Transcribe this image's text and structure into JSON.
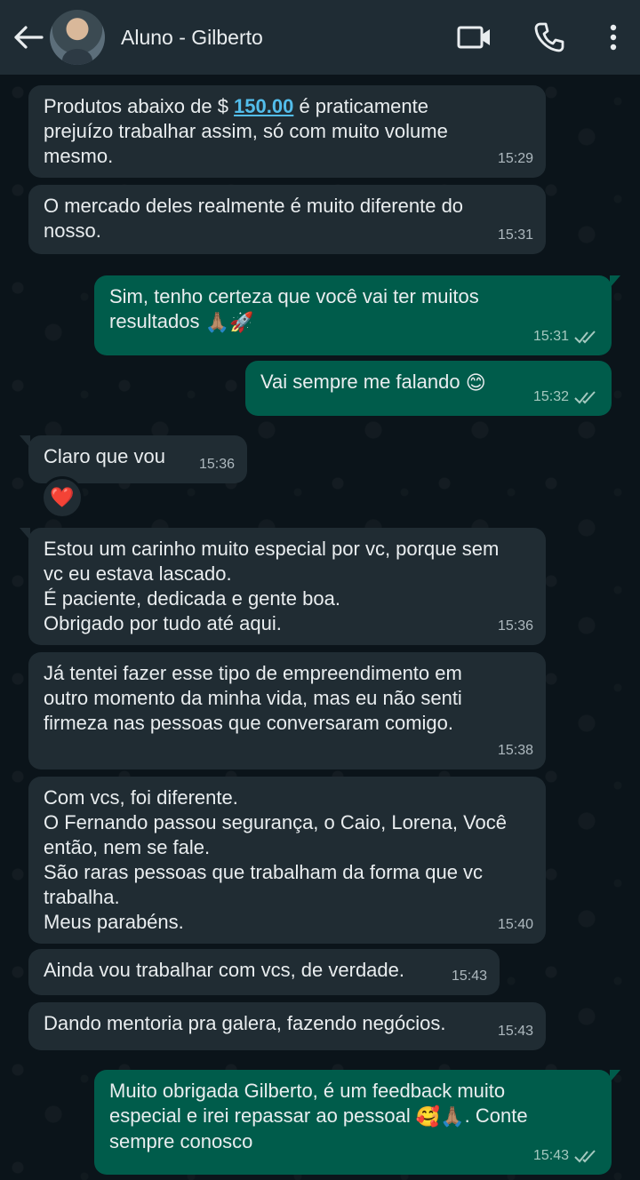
{
  "header": {
    "contact_name": "Aluno - Gilberto"
  },
  "icons": {
    "back": "arrow-left-icon",
    "video": "video-camera-icon",
    "call": "phone-icon",
    "menu": "more-vertical-icon",
    "read": "double-check-icon",
    "reaction": "red-heart-icon"
  },
  "messages": [
    {
      "dir": "in",
      "pre": "Produtos abaixo de $ ",
      "link": "150.00",
      "post": " é praticamente\nprejuízo trabalhar assim, só com muito volume\nmesmo.",
      "time": "15:29"
    },
    {
      "dir": "in",
      "text": "O mercado deles realmente é muito diferente do\nnosso.",
      "time": "15:31"
    },
    {
      "dir": "out",
      "text": "Sim, tenho certeza que você vai ter muitos\nresultados",
      "emojis": [
        "🙏🏽",
        "🚀"
      ],
      "time": "15:31"
    },
    {
      "dir": "out",
      "text": "Vai sempre me falando",
      "emojis": [
        "😊"
      ],
      "time": "15:32"
    },
    {
      "dir": "in",
      "text": "Claro que vou",
      "time": "15:36",
      "reaction": "❤️"
    },
    {
      "dir": "in",
      "text": "Estou um carinho muito especial por vc, porque sem\nvc eu estava lascado.\nÉ paciente, dedicada e gente boa.\nObrigado por tudo até aqui.",
      "time": "15:36"
    },
    {
      "dir": "in",
      "text": "Já tentei fazer esse tipo de empreendimento em\noutro momento da minha vida, mas eu não senti\nfirmeza nas pessoas que conversaram comigo.",
      "time": "15:38"
    },
    {
      "dir": "in",
      "text": "Com vcs, foi diferente.\nO Fernando passou segurança, o Caio, Lorena, Você\nentão, nem se fale.\nSão raras pessoas que trabalham da forma que vc\ntrabalha.\nMeus parabéns.",
      "time": "15:40"
    },
    {
      "dir": "in",
      "text": "Ainda vou trabalhar com vcs, de verdade.",
      "time": "15:43"
    },
    {
      "dir": "in",
      "text": "Dando mentoria pra galera, fazendo negócios.",
      "time": "15:43"
    },
    {
      "dir": "out",
      "pre": "Muito obrigada Gilberto, é um feedback muito\nespecial e irei repassar ao pessoal ",
      "emojis": [
        "🥰",
        "🙏🏽"
      ],
      "post": ". Conte\nsempre conosco",
      "time": "15:43"
    }
  ]
}
